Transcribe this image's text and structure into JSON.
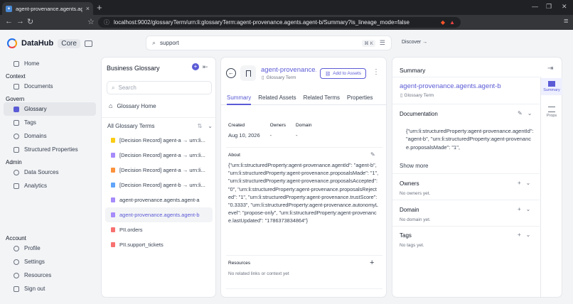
{
  "browser": {
    "tab_title": "agent-provenance.agents.agent-b",
    "url": "localhost:9002/glossaryTerm/urn:li:glossaryTerm:agent-provenance.agents.agent-b/Summary?is_lineage_mode=false"
  },
  "app": {
    "brand": "DataHub",
    "edition": "Core",
    "search_value": "support",
    "search_shortcut": "⌘ K",
    "discover": "Discover →"
  },
  "sidebar": {
    "home": "Home",
    "context_title": "Context",
    "documents": "Documents",
    "govern_title": "Govern",
    "glossary": "Glossary",
    "tags": "Tags",
    "domains": "Domains",
    "structured_properties": "Structured Properties",
    "admin_title": "Admin",
    "data_sources": "Data Sources",
    "analytics": "Analytics",
    "account_title": "Account",
    "profile": "Profile",
    "settings": "Settings",
    "resources": "Resources",
    "sign_out": "Sign out"
  },
  "glossary": {
    "title": "Business Glossary",
    "search_placeholder": "Search",
    "home": "Glossary Home",
    "all_terms": "All Glossary Terms",
    "terms": [
      {
        "label": "[Decision Record] agent-a → urn:li...",
        "color": "#facc15"
      },
      {
        "label": "[Decision Record] agent-a → urn:li...",
        "color": "#a78bfa"
      },
      {
        "label": "[Decision Record] agent-a → urn:li...",
        "color": "#fb923c"
      },
      {
        "label": "[Decision Record] agent-b → urn:li...",
        "color": "#60a5fa"
      },
      {
        "label": "agent-provenance.agents.agent-a",
        "color": "#a78bfa"
      },
      {
        "label": "agent-provenance.agents.agent-b",
        "color": "#a78bfa"
      },
      {
        "label": "PII.orders",
        "color": "#f87171"
      },
      {
        "label": "PII.support_tickets",
        "color": "#f87171"
      }
    ]
  },
  "entity": {
    "name": "agent-provenance...",
    "type": "Glossary Term",
    "add_to_assets": "Add to Assets",
    "tabs": [
      "Summary",
      "Related Assets",
      "Related Terms",
      "Properties"
    ],
    "created_label": "Created",
    "created_value": "Aug 10, 2026",
    "owners_label": "Owners",
    "owners_value": "-",
    "domain_label": "Domain",
    "domain_value": "-",
    "about_label": "About",
    "about_text": "{\"urn:li:structuredProperty:agent-provenance.agentId\": \"agent-b\", \"urn:li:structuredProperty:agent-provenance.proposalsMade\": \"1\", \"urn:li:structuredProperty:agent-provenance.proposalsAccepted\": \"0\", \"urn:li:structuredProperty:agent-provenance.proposalsRejected\": \"1\", \"urn:li:structuredProperty:agent-provenance.trustScore\": \"0.3333\", \"urn:li:structuredProperty:agent-provenance.autonomyLevel\": \"propose-only\", \"urn:li:structuredProperty:agent-provenance.lastUpdated\": \"1786373834864\"}",
    "resources_label": "Resources",
    "resources_empty": "No related links or context yet"
  },
  "summary": {
    "title": "Summary",
    "name": "agent-provenance.agents.agent-b",
    "type": "Glossary Term",
    "documentation_label": "Documentation",
    "documentation_text": "{\"urn:li:structuredProperty:agent-provenance.agentId\": \"agent-b\", \"urn:li:structuredProperty:agent-provenance.proposalsMade\": \"1\",",
    "show_more": "Show more",
    "owners_label": "Owners",
    "owners_empty": "No owners yet.",
    "domain_label": "Domain",
    "domain_empty": "No domain yet.",
    "tags_label": "Tags",
    "tags_empty": "No tags yet.",
    "rail_summary": "Summary",
    "rail_props": "Props"
  }
}
